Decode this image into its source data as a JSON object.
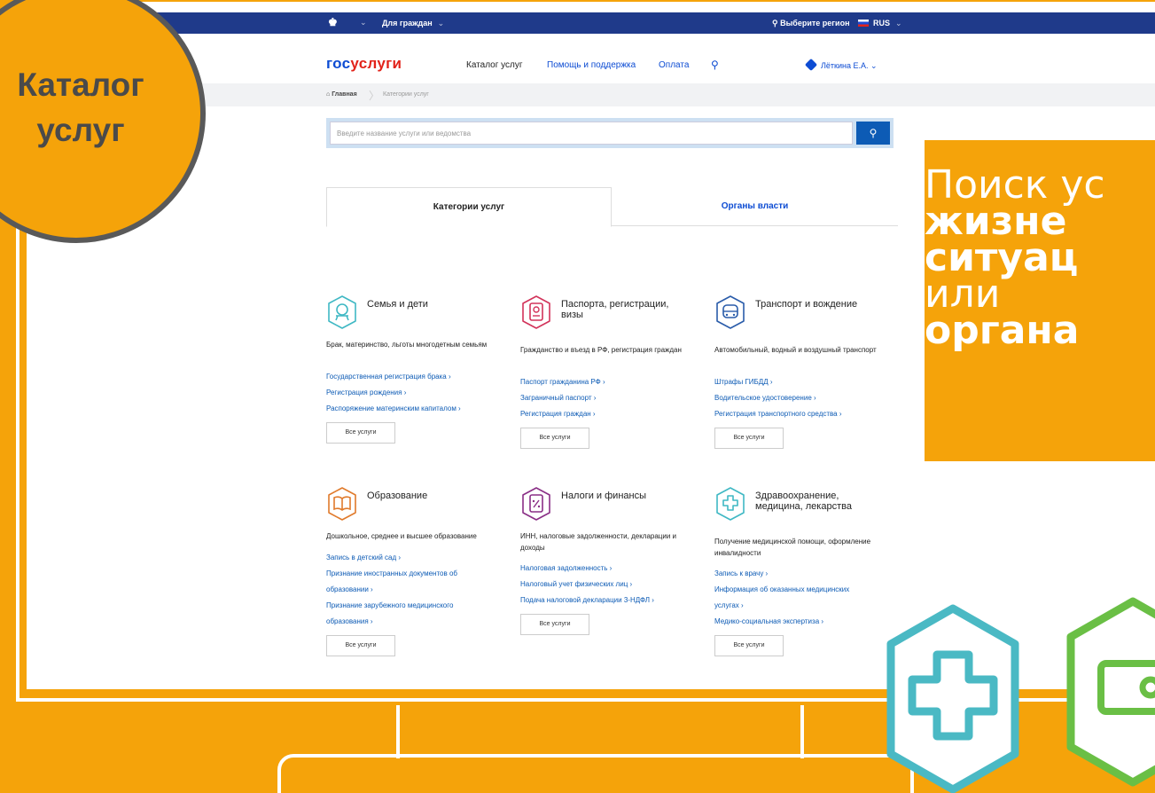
{
  "badge": {
    "line1": "Каталог",
    "line2": "услуг"
  },
  "promo": {
    "lines": [
      "Поиск ус",
      "жизне",
      "ситуац",
      "или",
      "органа"
    ]
  },
  "govbar": {
    "for_citizens": "Для граждан",
    "region": "Выберите регион",
    "lang": "RUS"
  },
  "nav": {
    "logo_a": "гос",
    "logo_b": "услуги",
    "catalog": "Каталог услуг",
    "help": "Помощь и поддержка",
    "payment": "Оплата",
    "user": "Лёткина Е.А."
  },
  "breadcrumbs": {
    "home": "Главная",
    "current": "Категории услуг"
  },
  "search": {
    "placeholder": "Введите название услуги или ведомства"
  },
  "tabs": {
    "categories": "Категории услуг",
    "authorities": "Органы власти"
  },
  "all_services": "Все услуги",
  "categories": [
    {
      "title": "Семья и дети",
      "desc": "Брак, материнство, льготы многодетным семьям",
      "links": [
        "Государственная регистрация брака ›",
        "Регистрация рождения ›",
        "Распоряжение материнским капиталом ›"
      ],
      "color": "#3fb8c4"
    },
    {
      "title": "Паспорта, регистрации, визы",
      "desc": "Гражданство и въезд в РФ, регистрация граждан",
      "links": [
        "Паспорт гражданина РФ ›",
        "Заграничный паспорт ›",
        "Регистрация граждан ›"
      ],
      "color": "#d2335a"
    },
    {
      "title": "Транспорт и вождение",
      "desc": "Автомобильный, водный и воздушный транспорт",
      "links": [
        "Штрафы ГИБДД ›",
        "Водительское удостоверение ›",
        "Регистрация транспортного средства ›"
      ],
      "color": "#2a5caa"
    },
    {
      "title": "Образование",
      "desc": "Дошкольное, среднее и высшее образование",
      "links": [
        "Запись в детский сад ›",
        "Признание иностранных документов об",
        "образовании ›",
        "Признание зарубежного медицинского",
        "образования ›"
      ],
      "color": "#e07a2b"
    },
    {
      "title": "Налоги и финансы",
      "desc": "ИНН, налоговые задолженности, декларации и доходы",
      "links": [
        "Налоговая задолженность ›",
        "Налоговый учет физических лиц ›",
        "Подача налоговой декларации 3-НДФЛ ›"
      ],
      "color": "#8a2f86"
    },
    {
      "title": "Здравоохранение, медицина, лекарства",
      "desc": "Получение медицинской помощи, оформление инвалидности",
      "links": [
        "Запись к врачу ›",
        "Информация об оказанных медицинских",
        "услугах ›",
        "Медико-социальная экспертиза ›"
      ],
      "color": "#3fb8c4"
    }
  ],
  "icons": {
    "cat0": "stroller-icon",
    "cat1": "passport-icon",
    "cat2": "car-icon",
    "cat3": "book-icon",
    "cat4": "tax-document-icon",
    "cat5": "medical-cross-icon",
    "hex1": "medical-cross-icon",
    "hex2": "wallet-icon"
  },
  "colors": {
    "accent": "#f5a30a",
    "brand_blue": "#0d4cd3",
    "brand_red": "#e2231a",
    "gov_bar": "#1f3a8a"
  }
}
